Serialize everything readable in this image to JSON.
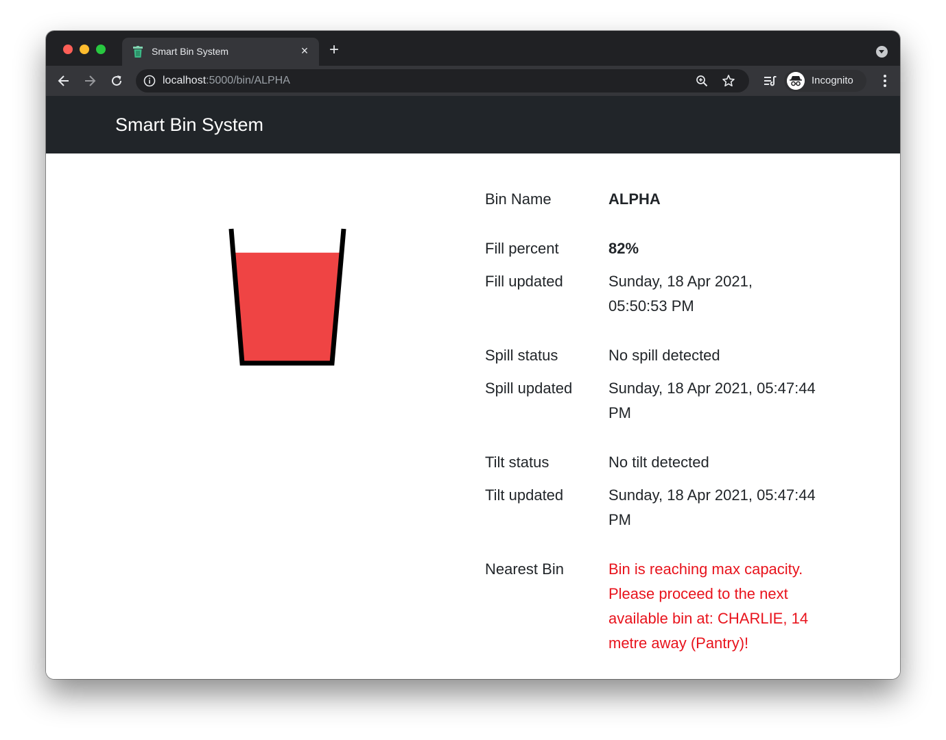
{
  "browser": {
    "tab_title": "Smart Bin System",
    "tab_close": "×",
    "new_tab": "+",
    "url_host": "localhost",
    "url_path": ":5000/bin/ALPHA",
    "profile_label": "Incognito"
  },
  "page": {
    "brand": "Smart Bin System",
    "fill_level": 0.82,
    "fill_color": "#ef4444",
    "navbar_color": "#212529",
    "alert_color": "#e8131c",
    "details": {
      "bin_name_label": "Bin Name",
      "bin_name": "ALPHA",
      "fill_percent_label": "Fill percent",
      "fill_percent": "82%",
      "fill_updated_label": "Fill updated",
      "fill_updated": "Sunday, 18 Apr 2021, 05:50:53 PM",
      "spill_status_label": "Spill status",
      "spill_status": "No spill detected",
      "spill_updated_label": "Spill updated",
      "spill_updated": "Sunday, 18 Apr 2021, 05:47:44 PM",
      "tilt_status_label": "Tilt status",
      "tilt_status": "No tilt detected",
      "tilt_updated_label": "Tilt updated",
      "tilt_updated": "Sunday, 18 Apr 2021, 05:47:44 PM",
      "nearest_bin_label": "Nearest Bin",
      "nearest_bin": "Bin is reaching max capacity. Please proceed to the next available bin at: CHARLIE, 14 metre away (Pantry)!"
    }
  },
  "icons": [
    "bin-favicon-icon",
    "close-icon",
    "plus-icon",
    "chevron-down-icon",
    "back-arrow-icon",
    "forward-arrow-icon",
    "reload-icon",
    "info-icon",
    "zoom-icon",
    "star-icon",
    "reading-list-icon",
    "incognito-icon",
    "more-vert-icon"
  ]
}
